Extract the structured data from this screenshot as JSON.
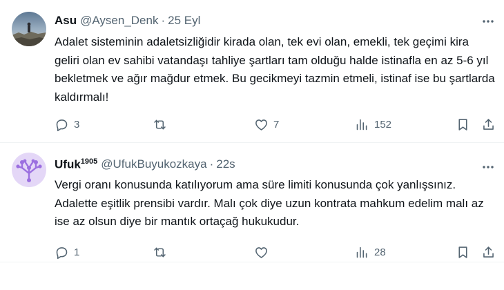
{
  "tweets": [
    {
      "name": "Asu",
      "handle": "@Aysen_Denk",
      "separator": "·",
      "time": "25 Eyl",
      "text": "Adalet sisteminin adaletsizliğidir kirada olan, tek evi olan, emekli, tek geçimi kira geliri olan ev sahibi vatandaşı tahliye şartları tam olduğu halde istinafla en az 5-6 yıl bekletmek ve ağır mağdur etmek. Bu gecikmeyi tazmin etmeli, istinaf ise bu şartlarda  kaldırmalı!",
      "replies": "3",
      "reposts": "",
      "likes": "7",
      "views": "152"
    },
    {
      "name": "Ufuk",
      "name_sup": "1905",
      "handle": "@UfukBuyukozkaya",
      "separator": "·",
      "time": "22s",
      "text": "Vergi oranı konusunda katılıyorum ama süre limiti konusunda çok yanlışsınız. Adalette eşitlik prensibi vardır. Malı çok diye uzun kontrata mahkum edelim malı az ise az olsun diye bir mantık ortaçağ hukukudur.",
      "replies": "1",
      "reposts": "",
      "likes": "",
      "views": "28"
    }
  ],
  "icons": {
    "reply": "reply-icon",
    "repost": "repost-icon",
    "like": "heart-icon",
    "views": "views-icon",
    "bookmark": "bookmark-icon",
    "share": "share-icon",
    "more": "more-icon"
  },
  "colors": {
    "text": "#0f1419",
    "muted": "#536471",
    "divider": "#eff3f4",
    "avatar2_bg": "#e4d7f7",
    "avatar2_accent": "#9b6fe0"
  }
}
